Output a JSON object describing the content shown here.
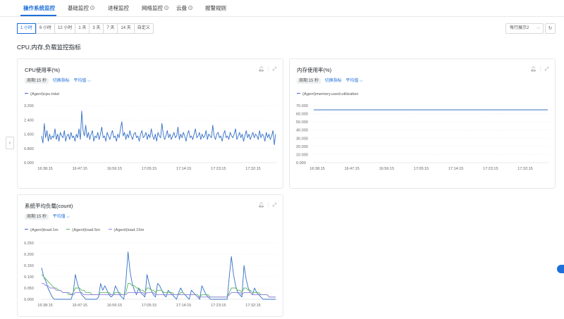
{
  "tabs": [
    {
      "label": "操作系统监控",
      "help": false,
      "active": true
    },
    {
      "label": "基础监控",
      "help": true
    },
    {
      "label": "进程监控",
      "help": false
    },
    {
      "label": "网络监控",
      "help": true
    },
    {
      "label": "云盘",
      "help": true
    },
    {
      "label": "报警规则",
      "help": false
    }
  ],
  "time_ranges": [
    "1 小时",
    "6 小时",
    "12 小时",
    "1 天",
    "3 天",
    "7 天",
    "14 天",
    "自定义"
  ],
  "time_range_active": "1 小时",
  "per_row": {
    "label": "每行展示2"
  },
  "section_title": "CPU,内存,负载监控指标",
  "icons": {
    "bell": "bell-icon",
    "expand": "expand-icon",
    "chevron": "chevron-down-icon",
    "refresh": "refresh-icon",
    "collapse": "chevron-left-icon"
  },
  "colors": {
    "accent": "#1e6fd9",
    "series1": "#3470c6",
    "series2": "#5cb85c",
    "series3": "#8f7fe0"
  },
  "cards": {
    "cpu": {
      "title": "CPU使用率(%)",
      "period": "周期:15 秒",
      "switch": "切换指标",
      "agg": "平均值"
    },
    "mem": {
      "title": "内存使用率(%)",
      "period": "周期:15 秒",
      "switch": "切换指标",
      "agg": "平均值"
    },
    "load": {
      "title": "系统平均负载(count)",
      "period": "周期:15 秒",
      "agg": "平均值"
    }
  },
  "x_ticks": [
    "16:38:15",
    "16:47:15",
    "16:56:15",
    "17:05:15",
    "17:14:15",
    "17:23:15",
    "17:32:15"
  ],
  "chart_data": [
    {
      "type": "line",
      "title": "CPU使用率(%)",
      "ylim": [
        0,
        3.2
      ],
      "yticks": [
        "3.200",
        "2.400",
        "1.600",
        "0.800",
        "0.000"
      ],
      "series": [
        {
          "name": "(Agent)cpu.total",
          "values": [
            1.5,
            1.1,
            2.2,
            1.4,
            1.8,
            1.2,
            1.6,
            1.3,
            1.5,
            1.4,
            1.9,
            1.3,
            1.6,
            1.2,
            1.7,
            1.5,
            1.4,
            1.8,
            1.2,
            1.5,
            1.6,
            1.3,
            1.7,
            1.4,
            1.5,
            1.2,
            1.6,
            1.4,
            1.9,
            1.3,
            2.9,
            1.8,
            1.5,
            2.1,
            1.4,
            1.7,
            1.3,
            1.6,
            1.8,
            1.2,
            1.5,
            1.4,
            1.7,
            1.3,
            1.6,
            2.0,
            1.4,
            1.5,
            1.2,
            1.7,
            1.5,
            1.3,
            1.6,
            1.8,
            1.4,
            1.5,
            1.2,
            1.6,
            1.4,
            1.9,
            2.3,
            1.5,
            1.7,
            1.3,
            1.6,
            1.4,
            1.8,
            1.5,
            1.3,
            1.6,
            1.7,
            1.4,
            1.5,
            1.2,
            1.6,
            1.8,
            1.4,
            1.5,
            1.7,
            1.3,
            1.6,
            1.4,
            1.9,
            1.5,
            1.3,
            1.6,
            1.2,
            1.7,
            1.5,
            1.4,
            2.2,
            1.6,
            1.3,
            1.5,
            1.8,
            1.4,
            1.6,
            1.3,
            1.5,
            1.7,
            1.4,
            1.5,
            2.0,
            1.3,
            1.6,
            1.4,
            1.7,
            1.5,
            1.2,
            1.6,
            1.8,
            1.4,
            1.5,
            1.3,
            1.6,
            1.9,
            1.4,
            1.5,
            1.7,
            1.3,
            1.6,
            1.4,
            1.5,
            1.8,
            1.3,
            1.6,
            1.5,
            1.4,
            2.1,
            1.5,
            1.3,
            1.6,
            1.7,
            1.4,
            1.5,
            1.2,
            1.6,
            1.8,
            1.4,
            1.5,
            1.3,
            1.7,
            1.5,
            1.4,
            1.6,
            1.9,
            1.3,
            1.5,
            1.7,
            1.4,
            1.6,
            1.2,
            1.5,
            1.8,
            1.4,
            1.6,
            1.3,
            1.5,
            1.7,
            1.4,
            1.6,
            1.5,
            1.3,
            1.8,
            1.4,
            1.6,
            1.5,
            1.2,
            1.7,
            1.4,
            1.6,
            1.3,
            1.5,
            1.8,
            1.0,
            1.6
          ]
        }
      ]
    },
    {
      "type": "line",
      "title": "内存使用率(%)",
      "ylim": [
        0,
        70
      ],
      "yticks": [
        "70.000",
        "60.000",
        "50.000",
        "40.000",
        "30.000",
        "20.000",
        "10.000",
        "0.000"
      ],
      "series": [
        {
          "name": "(Agent)memory.used.utilization",
          "values": [
            64.8,
            64.8,
            64.9,
            64.8,
            64.8,
            64.8,
            64.9,
            64.8,
            64.8,
            64.8,
            64.8,
            64.9,
            64.8,
            64.8,
            64.8,
            64.8,
            64.8,
            64.9,
            64.8,
            64.8,
            64.8,
            64.8,
            64.8,
            64.8,
            64.8,
            64.8,
            64.8,
            64.9,
            64.8,
            64.8,
            64.8,
            64.8,
            64.8,
            64.8,
            64.8,
            64.8,
            64.8,
            64.8,
            64.8,
            64.8
          ]
        }
      ]
    },
    {
      "type": "line",
      "title": "系统平均负载(count)",
      "ylim": [
        0,
        0.25
      ],
      "yticks": [
        "0.250",
        "0.200",
        "0.150",
        "0.100",
        "0.050",
        "0.000"
      ],
      "series": [
        {
          "name": "(Agent)load.1m",
          "values": [
            0.14,
            0.1,
            0.08,
            0.05,
            0.03,
            0.01,
            0.0,
            0.0,
            0.0,
            0.0,
            0.0,
            0.0,
            0.0,
            0.0,
            0.0,
            0.03,
            0.11,
            0.07,
            0.04,
            0.02,
            0.01,
            0.0,
            0.0,
            0.0,
            0.0,
            0.0,
            0.0,
            0.01,
            0.07,
            0.04,
            0.06,
            0.04,
            0.02,
            0.01,
            0.02,
            0.06,
            0.04,
            0.02,
            0.01,
            0.0,
            0.08,
            0.21,
            0.12,
            0.07,
            0.04,
            0.02,
            0.05,
            0.03,
            0.02,
            0.01,
            0.11,
            0.07,
            0.04,
            0.02,
            0.01,
            0.07,
            0.06,
            0.04,
            0.02,
            0.01,
            0.04,
            0.03,
            0.02,
            0.01,
            0.0,
            0.03,
            0.05,
            0.03,
            0.02,
            0.01,
            0.0,
            0.04,
            0.03,
            0.02,
            0.01,
            0.0,
            0.06,
            0.04,
            0.02,
            0.01,
            0.0,
            0.0,
            0.0,
            0.0,
            0.0,
            0.0,
            0.0,
            0.0,
            0.0,
            0.1,
            0.19,
            0.11,
            0.06,
            0.03,
            0.02,
            0.01,
            0.15,
            0.09,
            0.05,
            0.03,
            0.02,
            0.05,
            0.03,
            0.02,
            0.01,
            0.0,
            0.0,
            0.0,
            0.0,
            0.0,
            0.0,
            0.0
          ]
        },
        {
          "name": "(Agent)load.5m",
          "values": [
            0.11,
            0.1,
            0.09,
            0.08,
            0.07,
            0.06,
            0.05,
            0.05,
            0.04,
            0.04,
            0.03,
            0.03,
            0.03,
            0.02,
            0.02,
            0.03,
            0.05,
            0.05,
            0.05,
            0.04,
            0.04,
            0.03,
            0.03,
            0.03,
            0.02,
            0.02,
            0.02,
            0.02,
            0.03,
            0.03,
            0.03,
            0.03,
            0.03,
            0.02,
            0.02,
            0.03,
            0.03,
            0.03,
            0.02,
            0.02,
            0.03,
            0.07,
            0.07,
            0.06,
            0.06,
            0.05,
            0.05,
            0.04,
            0.04,
            0.03,
            0.05,
            0.05,
            0.04,
            0.04,
            0.03,
            0.04,
            0.04,
            0.04,
            0.03,
            0.03,
            0.03,
            0.03,
            0.03,
            0.02,
            0.02,
            0.02,
            0.03,
            0.03,
            0.02,
            0.02,
            0.02,
            0.02,
            0.02,
            0.02,
            0.02,
            0.01,
            0.02,
            0.02,
            0.02,
            0.02,
            0.01,
            0.01,
            0.01,
            0.01,
            0.01,
            0.01,
            0.01,
            0.01,
            0.01,
            0.03,
            0.05,
            0.05,
            0.05,
            0.04,
            0.04,
            0.03,
            0.05,
            0.05,
            0.04,
            0.04,
            0.03,
            0.03,
            0.03,
            0.03,
            0.02,
            0.02,
            0.02,
            0.02,
            0.01,
            0.01,
            0.01,
            0.01
          ]
        },
        {
          "name": "(Agent)load.15m",
          "values": [
            0.07,
            0.07,
            0.06,
            0.06,
            0.05,
            0.05,
            0.05,
            0.04,
            0.04,
            0.04,
            0.03,
            0.03,
            0.03,
            0.03,
            0.02,
            0.02,
            0.03,
            0.03,
            0.03,
            0.03,
            0.02,
            0.02,
            0.02,
            0.02,
            0.02,
            0.02,
            0.02,
            0.02,
            0.02,
            0.02,
            0.02,
            0.02,
            0.02,
            0.02,
            0.02,
            0.02,
            0.02,
            0.02,
            0.02,
            0.02,
            0.02,
            0.03,
            0.03,
            0.03,
            0.03,
            0.03,
            0.03,
            0.03,
            0.03,
            0.02,
            0.03,
            0.03,
            0.03,
            0.03,
            0.02,
            0.02,
            0.02,
            0.02,
            0.02,
            0.02,
            0.02,
            0.02,
            0.02,
            0.02,
            0.02,
            0.02,
            0.02,
            0.02,
            0.02,
            0.02,
            0.02,
            0.02,
            0.02,
            0.02,
            0.01,
            0.01,
            0.01,
            0.01,
            0.01,
            0.01,
            0.01,
            0.01,
            0.01,
            0.01,
            0.01,
            0.01,
            0.01,
            0.01,
            0.01,
            0.02,
            0.03,
            0.03,
            0.03,
            0.03,
            0.03,
            0.02,
            0.03,
            0.03,
            0.03,
            0.03,
            0.02,
            0.02,
            0.02,
            0.02,
            0.02,
            0.02,
            0.02,
            0.02,
            0.01,
            0.01,
            0.01,
            0.01
          ]
        }
      ]
    }
  ]
}
